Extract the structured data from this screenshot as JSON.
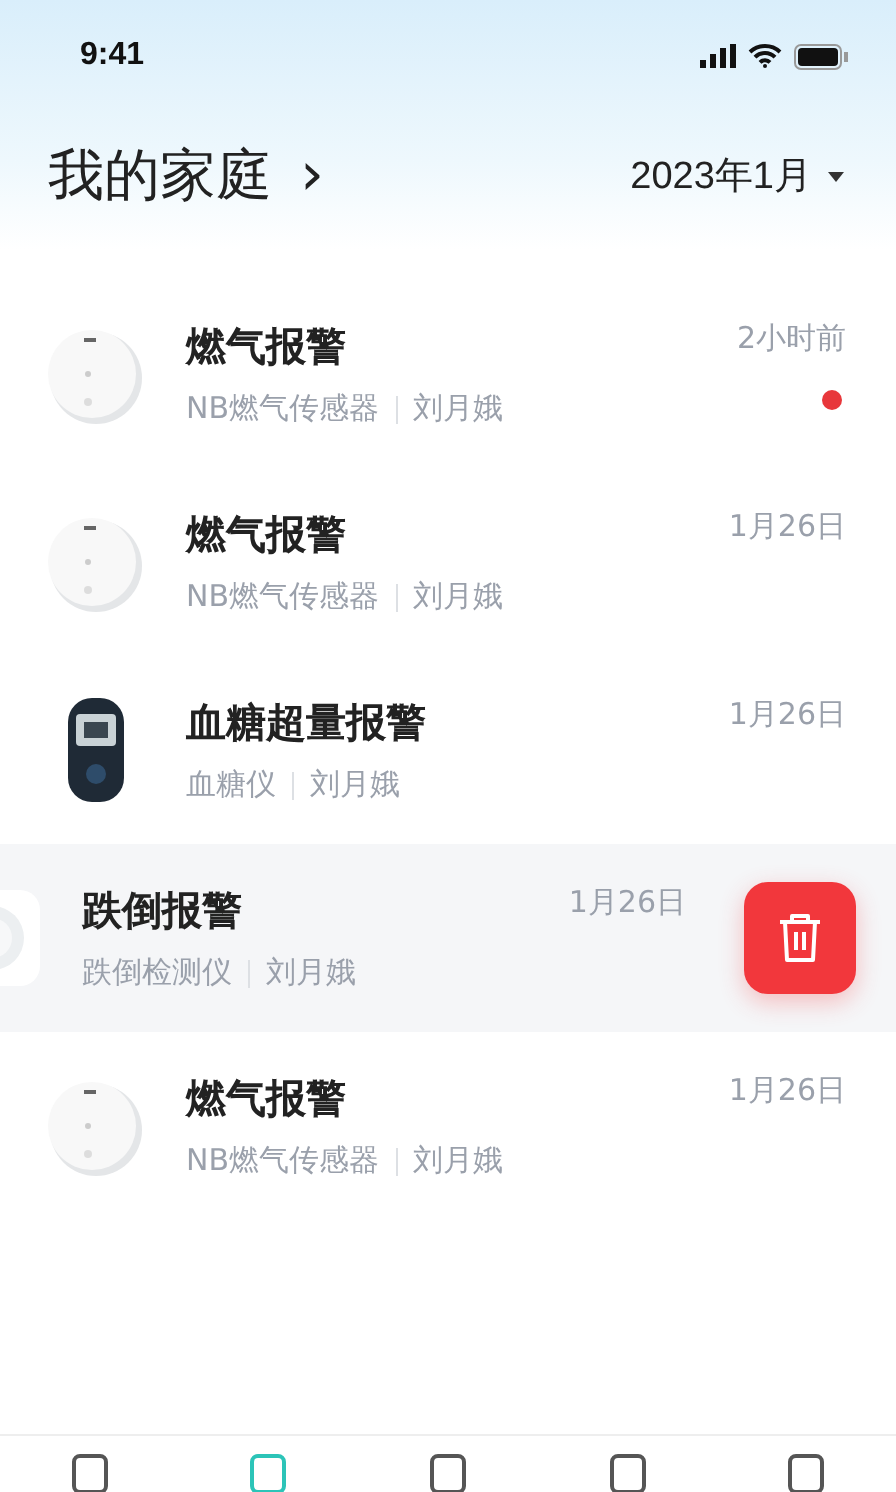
{
  "status_bar": {
    "time": "9:41"
  },
  "header": {
    "title": "我的家庭",
    "chevron": "›",
    "month": "2023年1月"
  },
  "alerts": [
    {
      "kind": "round-sensor",
      "title": "燃气报警",
      "device": "NB燃气传感器",
      "person": "刘月娥",
      "time": "2小时前",
      "unread": true,
      "swiped": false
    },
    {
      "kind": "round-sensor",
      "title": "燃气报警",
      "device": "NB燃气传感器",
      "person": "刘月娥",
      "time": "1月26日",
      "unread": false,
      "swiped": false
    },
    {
      "kind": "meter",
      "title": "血糖超量报警",
      "device": "血糖仪",
      "person": "刘月娥",
      "time": "1月26日",
      "unread": false,
      "swiped": false
    },
    {
      "kind": "square-sensor",
      "title": "跌倒报警",
      "device": "跌倒检测仪",
      "person": "刘月娥",
      "time": "1月26日",
      "unread": false,
      "swiped": true
    },
    {
      "kind": "round-sensor",
      "title": "燃气报警",
      "device": "NB燃气传感器",
      "person": "刘月娥",
      "time": "1月26日",
      "unread": false,
      "swiped": false
    }
  ],
  "tab_bar": [
    {
      "selected": false
    },
    {
      "selected": true
    },
    {
      "selected": false
    },
    {
      "selected": false
    },
    {
      "selected": false
    }
  ]
}
